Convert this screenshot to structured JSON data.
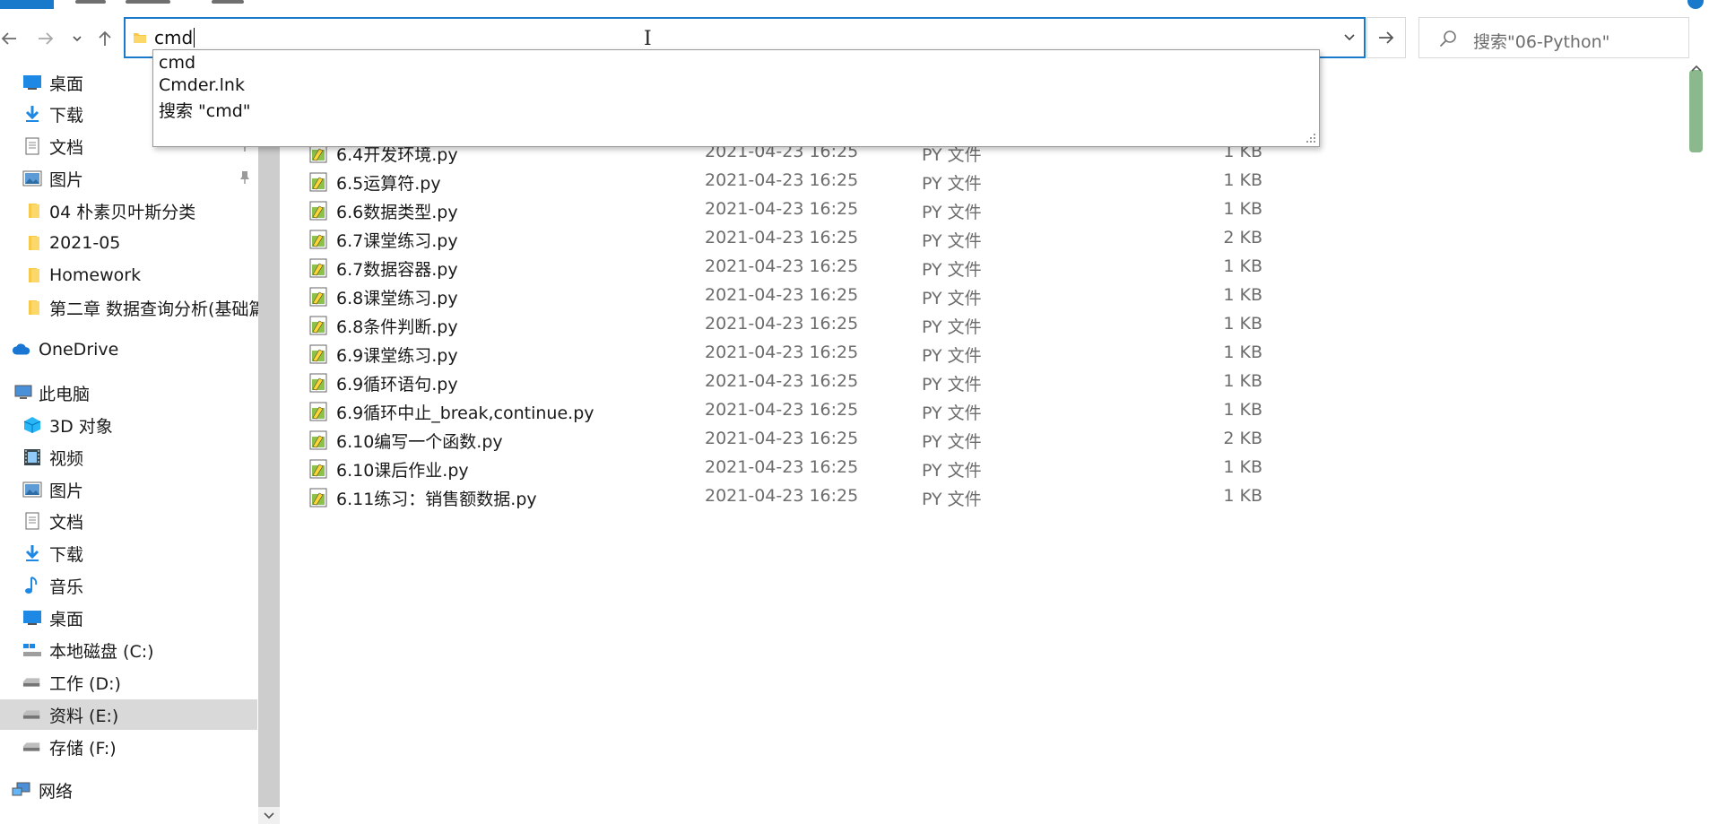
{
  "address_bar": {
    "value": "cmd"
  },
  "search": {
    "placeholder": "搜索\"06-Python\""
  },
  "suggestions": [
    "cmd",
    "Cmder.lnk",
    "搜索 \"cmd\""
  ],
  "sidebar": {
    "quick_access": [
      {
        "label": "桌面",
        "icon": "desktop-icon"
      },
      {
        "label": "下载",
        "icon": "download-icon"
      },
      {
        "label": "文档",
        "icon": "document-icon"
      },
      {
        "label": "图片",
        "icon": "picture-icon"
      },
      {
        "label": "04 朴素贝叶斯分类",
        "icon": "folder-icon"
      },
      {
        "label": "2021-05",
        "icon": "folder-icon"
      },
      {
        "label": "Homework",
        "icon": "folder-icon"
      },
      {
        "label": "第二章 数据查询分析(基础篇)",
        "icon": "folder-icon"
      }
    ],
    "onedrive": {
      "label": "OneDrive",
      "icon": "onedrive-cloud-icon"
    },
    "this_pc": {
      "label": "此电脑",
      "icon": "pc-icon"
    },
    "pc_items": [
      {
        "label": "3D 对象",
        "icon": "3d-objects-icon"
      },
      {
        "label": "视频",
        "icon": "video-icon"
      },
      {
        "label": "图片",
        "icon": "picture-icon"
      },
      {
        "label": "文档",
        "icon": "document-icon"
      },
      {
        "label": "下载",
        "icon": "download-icon"
      },
      {
        "label": "音乐",
        "icon": "music-icon"
      },
      {
        "label": "桌面",
        "icon": "desktop-icon"
      },
      {
        "label": "本地磁盘 (C:)",
        "icon": "system-drive-icon"
      },
      {
        "label": "工作 (D:)",
        "icon": "drive-icon"
      },
      {
        "label": "资料 (E:)",
        "icon": "drive-icon",
        "selected": true
      },
      {
        "label": "存储 (F:)",
        "icon": "drive-icon"
      }
    ],
    "network": {
      "label": "网络",
      "icon": "network-icon"
    }
  },
  "files": [
    {
      "name": "6.4开发环境.py",
      "date": "2021-04-23 16:25",
      "type": "PY 文件",
      "size": "1 KB"
    },
    {
      "name": "6.5运算符.py",
      "date": "2021-04-23 16:25",
      "type": "PY 文件",
      "size": "1 KB"
    },
    {
      "name": "6.6数据类型.py",
      "date": "2021-04-23 16:25",
      "type": "PY 文件",
      "size": "1 KB"
    },
    {
      "name": "6.7课堂练习.py",
      "date": "2021-04-23 16:25",
      "type": "PY 文件",
      "size": "2 KB"
    },
    {
      "name": "6.7数据容器.py",
      "date": "2021-04-23 16:25",
      "type": "PY 文件",
      "size": "1 KB"
    },
    {
      "name": "6.8课堂练习.py",
      "date": "2021-04-23 16:25",
      "type": "PY 文件",
      "size": "1 KB"
    },
    {
      "name": "6.8条件判断.py",
      "date": "2021-04-23 16:25",
      "type": "PY 文件",
      "size": "1 KB"
    },
    {
      "name": "6.9课堂练习.py",
      "date": "2021-04-23 16:25",
      "type": "PY 文件",
      "size": "1 KB"
    },
    {
      "name": "6.9循环语句.py",
      "date": "2021-04-23 16:25",
      "type": "PY 文件",
      "size": "1 KB"
    },
    {
      "name": "6.9循环中止_break,continue.py",
      "date": "2021-04-23 16:25",
      "type": "PY 文件",
      "size": "1 KB"
    },
    {
      "name": "6.10编写一个函数.py",
      "date": "2021-04-23 16:25",
      "type": "PY 文件",
      "size": "2 KB"
    },
    {
      "name": "6.10课后作业.py",
      "date": "2021-04-23 16:25",
      "type": "PY 文件",
      "size": "1 KB"
    },
    {
      "name": "6.11练习：销售额数据.py",
      "date": "2021-04-23 16:25",
      "type": "PY 文件",
      "size": "1 KB"
    }
  ],
  "colors": {
    "accent": "#1979ca",
    "selected_bg": "#d9d9d9",
    "folder": "#f7c948"
  }
}
